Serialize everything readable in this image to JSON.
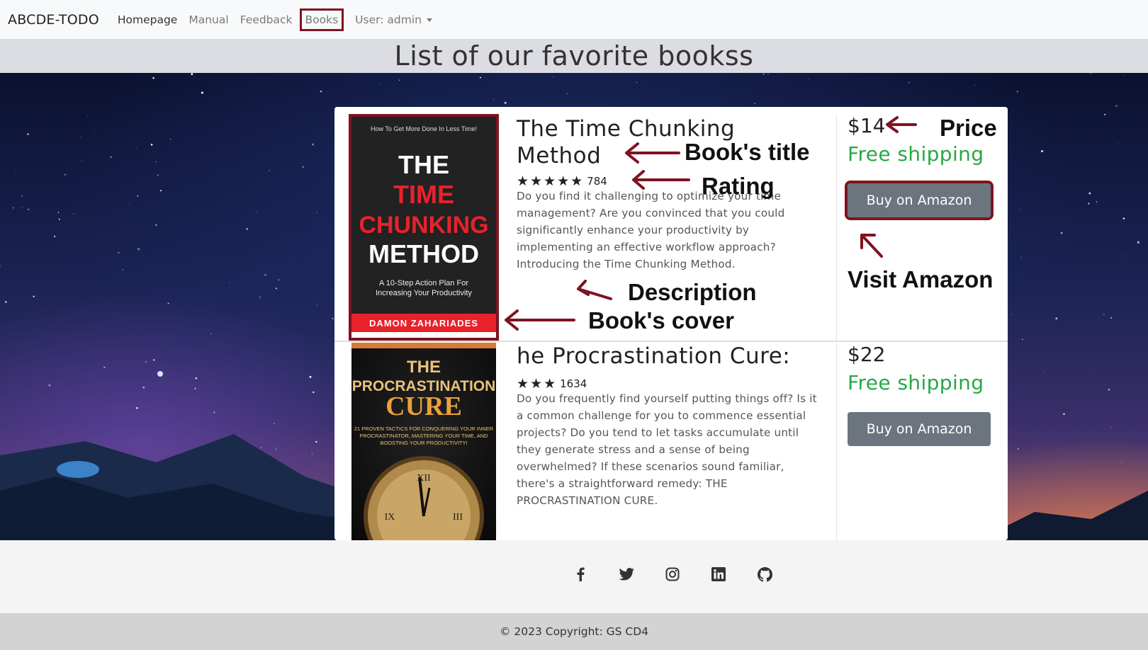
{
  "navbar": {
    "brand": "ABCDE-TODO",
    "links": [
      "Homepage",
      "Manual",
      "Feedback",
      "Books"
    ],
    "user_menu": "User: admin"
  },
  "page": {
    "heading": "List of our favorite bookss"
  },
  "books": [
    {
      "title": "The Time Chunking Method",
      "stars": "★★★★★",
      "rating_count": "784",
      "description": "Do you find it challenging to optimize your time management? Are you convinced that you could significantly enhance your productivity by implementing an effective workflow approach? Introducing the Time Chunking Method.",
      "price": "$14",
      "shipping": "Free shipping",
      "button": "Buy on Amazon",
      "cover": {
        "top": "How To Get More Done In Less Time!",
        "line1": "THE",
        "line2": "TIME",
        "line3": "CHUNKING",
        "line4": "METHOD",
        "subtitle": "A 10-Step Action Plan For Increasing Your Productivity",
        "author": "DAMON ZAHARIADES"
      }
    },
    {
      "title": "he Procrastination Cure:",
      "stars": "★★★",
      "rating_count": "1634",
      "description": "Do you frequently find yourself putting things off? Is it a common challenge for you to commence essential projects? Do you tend to let tasks accumulate until they generate stress and a sense of being overwhelmed? If these scenarios sound familiar, there's a straightforward remedy: THE PROCRASTINATION CURE.",
      "price": "$22",
      "shipping": "Free shipping",
      "button": "Buy on Amazon",
      "cover": {
        "line1": "THE",
        "line2": "PROCRASTINATION",
        "line3": "CURE",
        "subtitle": "21 PROVEN TACTICS FOR CONQUERING YOUR INNER PROCRASTINATOR, MASTERING YOUR TIME, AND BOOSTING YOUR PRODUCTIVITY!"
      }
    }
  ],
  "annotations": {
    "price": "Price",
    "title": "Book's title",
    "rating": "Rating",
    "visit": "Visit Amazon",
    "description": "Description",
    "cover": "Book's cover"
  },
  "footer": {
    "icons": [
      "facebook-icon",
      "twitter-icon",
      "instagram-icon",
      "linkedin-icon",
      "github-icon"
    ],
    "copyright": "© 2023 Copyright: GS CD4"
  },
  "colors": {
    "annotation": "#7d1420",
    "shipping": "#28a745",
    "button": "#6c757d"
  }
}
